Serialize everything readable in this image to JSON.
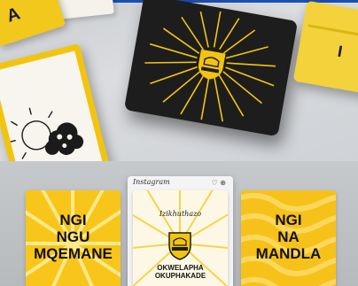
{
  "top_photo": {
    "left_card_fragment": "A",
    "right_card_fragment": "I"
  },
  "instagram": {
    "label": "Instagram",
    "heart_icon": "heart-icon",
    "menu_icon": "more-icon"
  },
  "posts": [
    {
      "lines": [
        "NGI",
        "NGU",
        "MQEMANE"
      ]
    },
    {
      "script": "Izikhuthazo",
      "caption": [
        "OKWELAPHA",
        "OKUPHAKADE"
      ]
    },
    {
      "lines": [
        "NGI",
        "NA",
        "MANDLA"
      ]
    }
  ],
  "colors": {
    "accent_yellow": "#f6c21a",
    "dark_card": "#1d1d1d",
    "brand_blue": "#1a4fb4"
  }
}
